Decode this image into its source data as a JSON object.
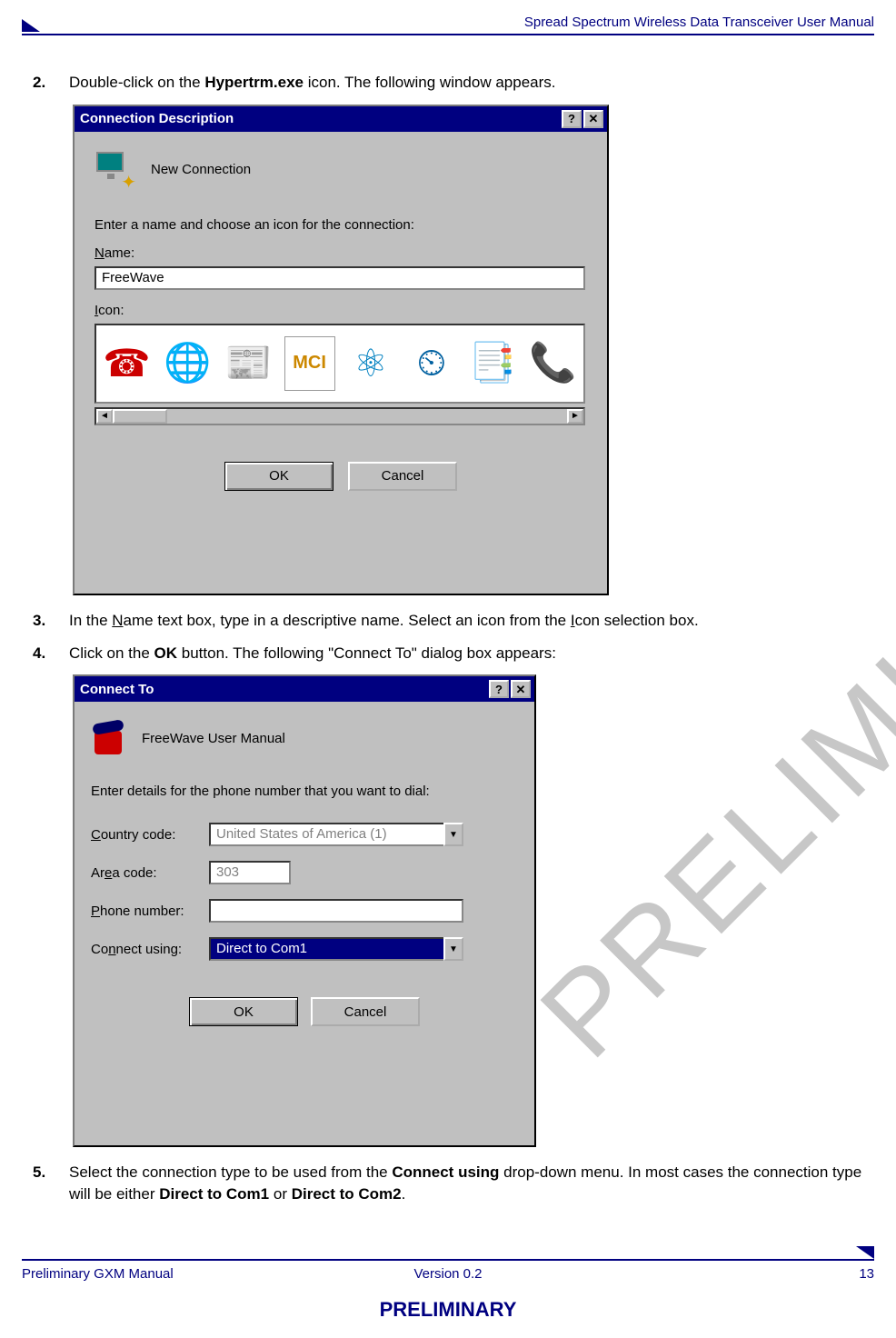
{
  "header": {
    "title": "Spread Spectrum Wireless Data Transceiver User Manual"
  },
  "steps": {
    "s2": {
      "num": "2.",
      "pre": "Double-click on the ",
      "bold": "Hypertrm.exe",
      "post": " icon. The following window appears."
    },
    "s3": {
      "num": "3.",
      "t1": "In the ",
      "u1": "N",
      "t2": "ame text box, type in a descriptive name. Select an icon from the ",
      "u2": "I",
      "t3": "con selection box."
    },
    "s4": {
      "num": "4.",
      "t1": "Click on the ",
      "bold": "OK",
      "t2": " button. The following \"Connect To\" dialog box appears:"
    },
    "s5": {
      "num": "5.",
      "t1": "Select the connection type to be used from the ",
      "b1": "Connect using",
      "t2": " drop-down menu. In most cases the connection type will be either ",
      "b2": "Direct to Com1",
      "t3": " or ",
      "b3": "Direct to Com2",
      "t4": "."
    }
  },
  "dlg1": {
    "title": "Connection Description",
    "help_btn": "?",
    "close_btn": "✕",
    "new_conn_label": "New Connection",
    "prompt": "Enter a name and choose an icon for the connection:",
    "name_label_u": "N",
    "name_label": "ame:",
    "name_value": "FreeWave",
    "icon_label_u": "I",
    "icon_label": "con:",
    "scroll_left": "◄",
    "scroll_right": "►",
    "ok": "OK",
    "cancel": "Cancel"
  },
  "dlg2": {
    "title": "Connect To",
    "help_btn": "?",
    "close_btn": "✕",
    "conn_name": "FreeWave User Manual",
    "prompt": "Enter details for the phone number that you want to dial:",
    "country_u": "C",
    "country_label": "ountry code:",
    "country_value": "United States of America (1)",
    "area_u": "e",
    "area_pre": "Ar",
    "area_post": "a code:",
    "area_value": "303",
    "phone_u": "P",
    "phone_label": "hone number:",
    "phone_value": "",
    "connect_u": "n",
    "connect_pre": "Co",
    "connect_post": "nect using:",
    "connect_value": "Direct to Com1",
    "ok": "OK",
    "cancel": "Cancel"
  },
  "watermark": "PRELIMINARY",
  "footer": {
    "left": "Preliminary GXM Manual",
    "mid": "Version 0.2",
    "right": "13",
    "prelim": "PRELIMINARY"
  }
}
